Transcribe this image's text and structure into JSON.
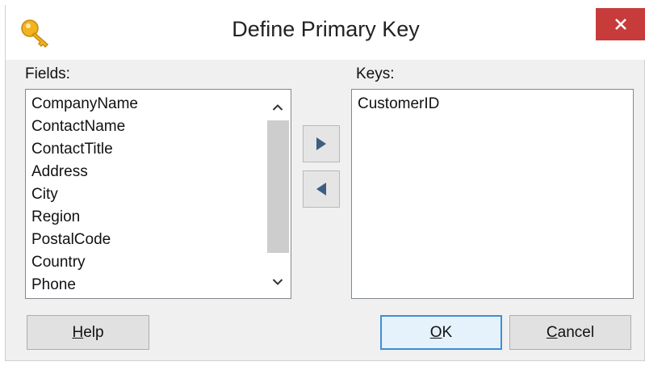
{
  "dialog": {
    "title": "Define Primary Key",
    "title_icon": "key-icon",
    "close_icon": "close-icon",
    "close_color": "#c73b3b"
  },
  "fields": {
    "label": "Fields:",
    "items": [
      "CompanyName",
      "ContactName",
      "ContactTitle",
      "Address",
      "City",
      "Region",
      "PostalCode",
      "Country",
      "Phone"
    ],
    "scroll_up_icon": "chevron-up-icon",
    "scroll_down_icon": "chevron-down-icon"
  },
  "keys": {
    "label": "Keys:",
    "items": [
      "CustomerID"
    ]
  },
  "transfer": {
    "add_icon": "arrow-right-icon",
    "remove_icon": "arrow-left-icon"
  },
  "buttons": {
    "help": {
      "accel": "H",
      "rest": "elp"
    },
    "ok": {
      "accel": "O",
      "rest": "K"
    },
    "cancel": {
      "accel": "C",
      "rest": "ancel"
    }
  }
}
